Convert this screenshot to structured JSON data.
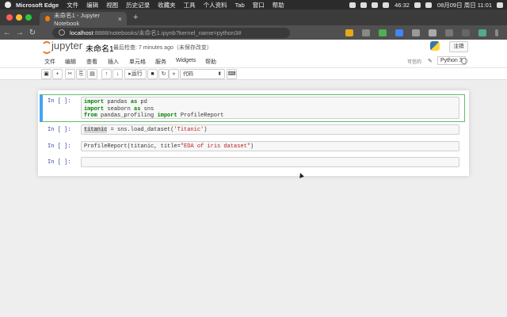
{
  "os_menubar": {
    "app": "Microsoft Edge",
    "items": [
      "文件",
      "编辑",
      "视图",
      "历史记录",
      "收藏夹",
      "工具",
      "个人资料",
      "Tab",
      "窗口",
      "帮助"
    ],
    "battery": "46:32",
    "datetime": "08月09日 周日 11:01"
  },
  "browser": {
    "tab_title": "未命名1 - Jupyter Notebook",
    "new_tab": "+",
    "url_host": "localhost",
    "url_path": ":8888/notebooks/未命名1.ipynb?kernel_name=python3#"
  },
  "jupyter": {
    "logo_text": "jupyter",
    "notebook_name": "未命名1",
    "checkpoint": "最后检查: 7 minutes ago（未保存改变）",
    "logout": "注销",
    "menu": [
      "文件",
      "编辑",
      "查看",
      "插入",
      "单元格",
      "服务",
      "Widgets",
      "帮助"
    ],
    "trusted": "可信的",
    "kernel": "Python 3",
    "toolbar": {
      "run_label": "运行",
      "cell_type": "代码"
    }
  },
  "cells": [
    {
      "prompt": "In [ ]:",
      "lines": [
        "import pandas as pd",
        "import seaborn as sns",
        "from pandas_profiling import ProfileReport"
      ]
    },
    {
      "prompt": "In [ ]:",
      "code": "titanic = sns.load_dataset('Titanic')"
    },
    {
      "prompt": "In [ ]:",
      "code": "ProfileReport(titanic, title=\"EDA of iris dataset\")"
    },
    {
      "prompt": "In [ ]:",
      "code": ""
    }
  ]
}
